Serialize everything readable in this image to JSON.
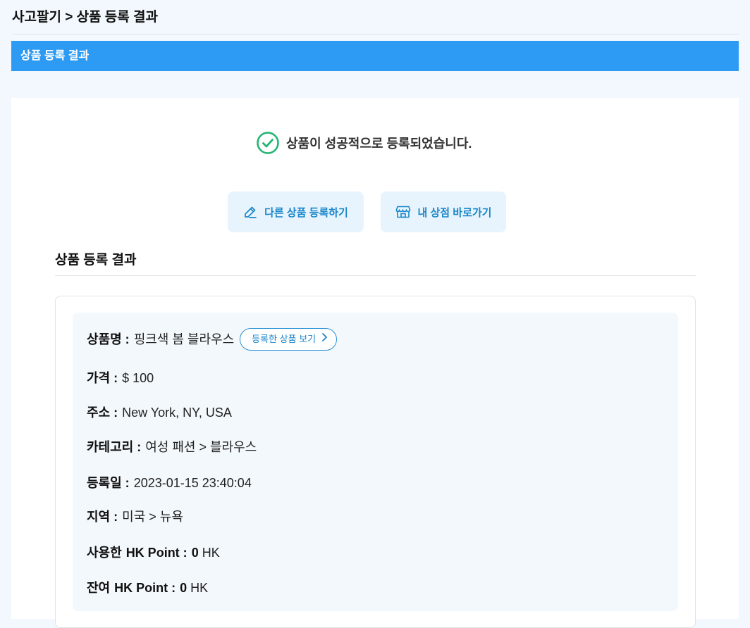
{
  "breadcrumb": "사고팔기 > 상품 등록 결과",
  "title_bar": "상품 등록 결과",
  "success_message": "상품이 성공적으로 등록되었습니다.",
  "buttons": {
    "register_another": "다른 상품 등록하기",
    "go_store": "내 상점 바로가기",
    "view_item": "등록한 상품 보기"
  },
  "section_title": "상품 등록 결과",
  "details": {
    "name_label": "상품명 :",
    "name_value": "핑크색 봄 블라우스",
    "price_label": "가격 :",
    "price_value": "$ 100",
    "address_label": "주소 :",
    "address_value": "New York, NY, USA",
    "category_label": "카테고리 :",
    "category_value": "여성 패션 > 블라우스",
    "date_label": "등록일 :",
    "date_value": "2023-01-15 23:40:04",
    "region_label": "지역 :",
    "region_value": "미국 > 뉴욕",
    "used_point_label_a": "사용한",
    "used_point_label_b": "HK Point :",
    "used_point_value": "0",
    "used_point_unit": "HK",
    "balance_label_a": "잔여",
    "balance_label_b": "HK Point :",
    "balance_value": "0",
    "balance_unit": "HK"
  },
  "icons": {
    "success": "check-circle-icon",
    "register": "pencil-icon",
    "store": "store-icon",
    "view": "chevron-right-icon"
  },
  "colors": {
    "accent": "#2d9bf3",
    "success": "#22b573",
    "button_bg": "#e7f4fd",
    "button_text": "#1a86c9"
  }
}
